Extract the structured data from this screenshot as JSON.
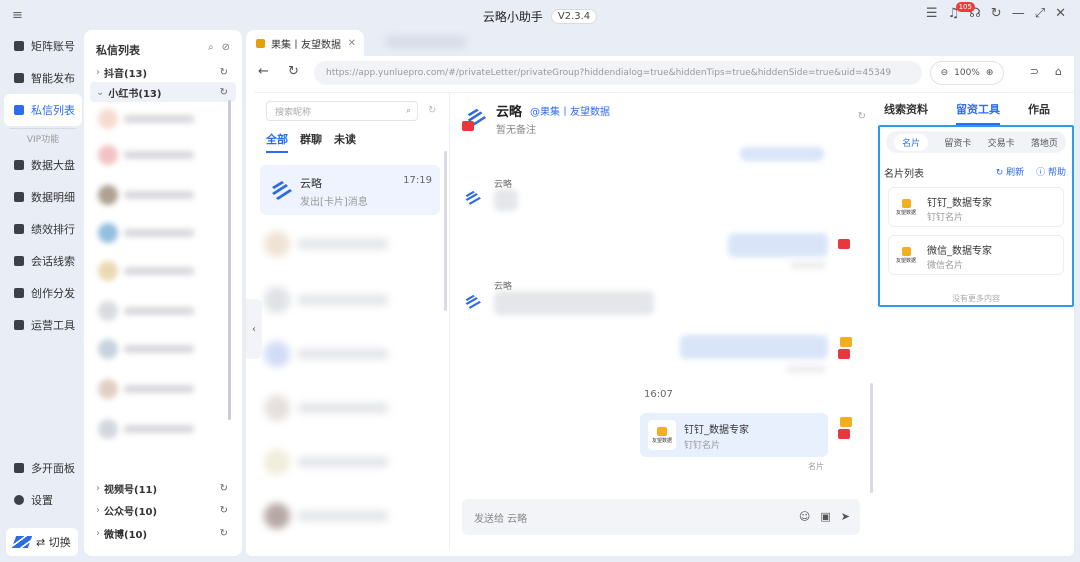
{
  "window": {
    "title": "云略小助手",
    "version": "V2.3.4",
    "notification_count": "105"
  },
  "nav": {
    "items": [
      {
        "label": "矩阵账号"
      },
      {
        "label": "智能发布"
      },
      {
        "label": "私信列表"
      },
      {
        "label": "数据大盘"
      },
      {
        "label": "数据明细"
      },
      {
        "label": "绩效排行"
      },
      {
        "label": "会话线索"
      },
      {
        "label": "创作分发"
      },
      {
        "label": "运营工具"
      }
    ],
    "vip_label": "VIP功能",
    "bottom": [
      {
        "label": "多开面板"
      },
      {
        "label": "设置"
      }
    ],
    "switch_label": "⇄ 切换"
  },
  "dm_panel": {
    "title": "私信列表",
    "accounts_top": [
      {
        "label": "抖音(13)"
      },
      {
        "label": "小红书(13)"
      }
    ],
    "accounts_bottom": [
      {
        "label": "视频号(11)"
      },
      {
        "label": "公众号(10)"
      },
      {
        "label": "微博(10)"
      }
    ]
  },
  "browser": {
    "tab_title": "果集丨友望数据",
    "url": "https://app.yunluepro.com/#/privateLetter/privateGroup?hiddendialog=true&hiddenTips=true&hiddenSide=true&uid=45349",
    "zoom": "100%"
  },
  "conversations": {
    "search_placeholder": "搜索昵称",
    "tabs": [
      "全部",
      "群聊",
      "未读"
    ],
    "active": {
      "name": "云略",
      "time": "17:19",
      "preview": "发出[卡片]消息"
    }
  },
  "chat": {
    "name": "云略",
    "tag": "@果集丨友望数据",
    "note": "暂无备注",
    "sender1": "云略",
    "sender2": "云略",
    "time_sep": "16:07",
    "card": {
      "title": "钉钉_数据专家",
      "sub": "钉钉名片",
      "logo_text": "友望数据"
    },
    "card_type": "名片",
    "compose_placeholder": "发送给 云略"
  },
  "tools": {
    "tabs": [
      "线索资料",
      "留资工具",
      "作品"
    ],
    "sub_tabs": [
      "名片",
      "留资卡",
      "交易卡",
      "落地页"
    ],
    "list_title": "名片列表",
    "refresh": "刷新",
    "help": "帮助",
    "cards": [
      {
        "title": "钉钉_数据专家",
        "sub": "钉钉名片",
        "logo_text": "友望数据"
      },
      {
        "title": "微信_数据专家",
        "sub": "微信名片",
        "logo_text": "友望数据"
      }
    ],
    "no_more": "没有更多内容"
  },
  "colors": {
    "accent": "#2d6cf2",
    "highlight_border": "#2d9be6",
    "xhs_red": "#e8383d",
    "brand_yellow": "#f2b01e"
  }
}
